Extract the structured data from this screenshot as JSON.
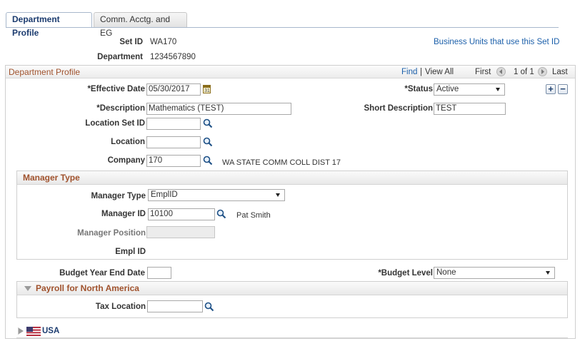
{
  "tabs": [
    {
      "label": "Department Profile",
      "active": true
    },
    {
      "label": "Comm. Acctg. and EG",
      "active": false
    }
  ],
  "header": {
    "setid_label": "Set ID",
    "setid_value": "WA170",
    "dept_label": "Department",
    "dept_value": "1234567890",
    "bu_link": "Business Units that use this Set ID"
  },
  "profile": {
    "title": "Department Profile",
    "nav": {
      "find": "Find",
      "sep": "|",
      "view_all": "View All",
      "first": "First",
      "count": "1 of 1",
      "last": "Last"
    },
    "eff_date_label": "*Effective Date",
    "eff_date_value": "05/30/2017",
    "status_label": "*Status",
    "status_value": "Active",
    "desc_label": "*Description",
    "desc_value": "Mathematics (TEST)",
    "short_desc_label": "Short Description",
    "short_desc_value": "TEST",
    "location_setid_label": "Location Set ID",
    "location_setid_value": "",
    "location_label": "Location",
    "location_value": "",
    "company_label": "Company",
    "company_value": "170",
    "company_desc": "WA STATE COMM COLL DIST 17",
    "add_row": "+",
    "delete_row": "−"
  },
  "manager": {
    "title": "Manager Type",
    "type_label": "Manager Type",
    "type_value": "EmplID",
    "id_label": "Manager ID",
    "id_value": "10100",
    "id_name": "Pat Smith",
    "position_label": "Manager Position",
    "position_value": "",
    "emplid_label": "Empl ID"
  },
  "budget": {
    "year_end_label": "Budget Year End Date",
    "year_end_value": "",
    "level_label": "*Budget Level",
    "level_value": "None"
  },
  "payroll": {
    "title": "Payroll for North America",
    "tax_location_label": "Tax Location",
    "tax_location_value": ""
  },
  "country": {
    "label": "USA"
  },
  "colors": {
    "link": "#1b5faa",
    "section_header": "#a0522d",
    "tab_active": "#ffffff"
  }
}
